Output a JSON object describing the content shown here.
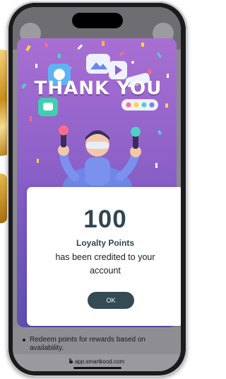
{
  "banner": {
    "title": "THANK YOU"
  },
  "dialog": {
    "points": "100",
    "points_label": "Loyalty Points",
    "message": "has been credited to your account",
    "ok_label": "OK"
  },
  "page": {
    "bullet_text": "Redeem points for rewards based on availability."
  },
  "browser": {
    "url": "app.smartkood.com"
  },
  "colors": {
    "card_top": "#a86fd3",
    "card_bottom": "#5e4fb3",
    "accent_dark": "#344a55",
    "heading_text": "#2f4652"
  }
}
